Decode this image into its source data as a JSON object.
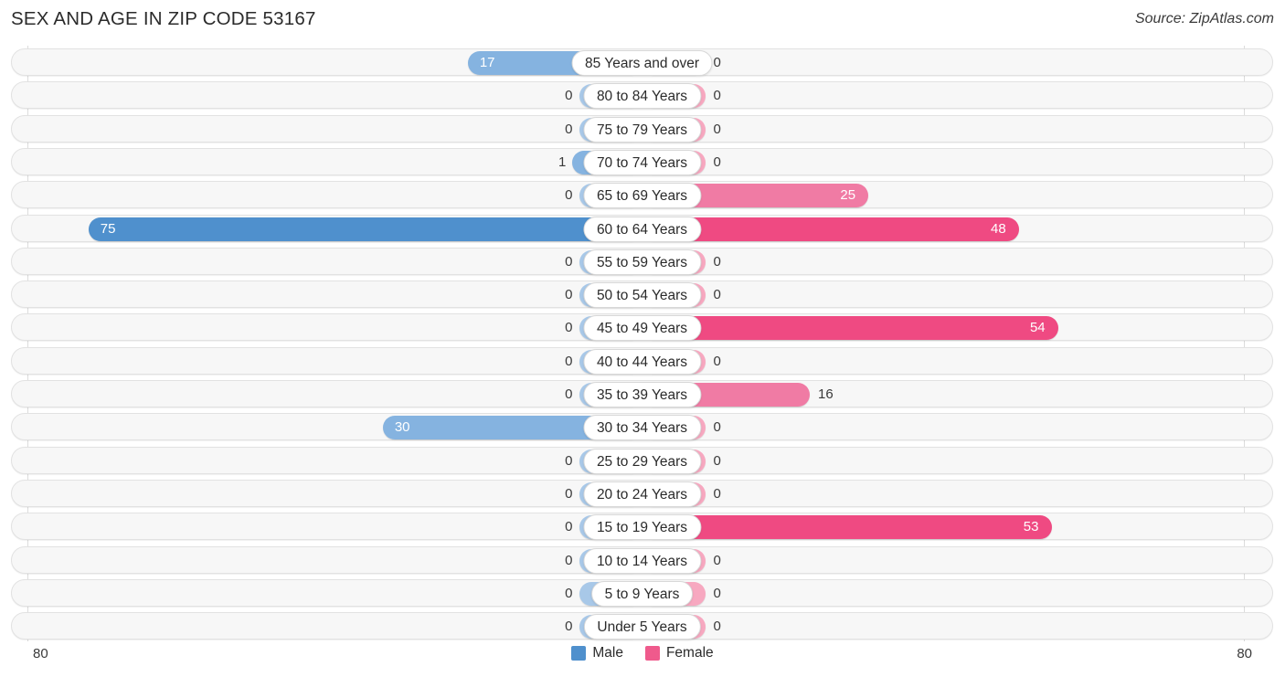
{
  "header": {
    "title": "SEX AND AGE IN ZIP CODE 53167",
    "source": "Source: ZipAtlas.com"
  },
  "legend": {
    "male_label": "Male",
    "female_label": "Female",
    "male_color": "#4f90cd",
    "female_color": "#ef5a8c"
  },
  "axis": {
    "left_max_label": "80",
    "right_max_label": "80",
    "max": 80
  },
  "colors": {
    "male_strong": "#4f90cd",
    "male_light": "#a8c8e8",
    "male_mid": "#85b3e0",
    "female_strong": "#ef4a82",
    "female_light": "#f7a8c0",
    "female_mid": "#f07ba4",
    "track": "#f7f7f7",
    "track_border": "#e2e2e2",
    "gridline": "#dcdcdc"
  },
  "chart_data": {
    "type": "bar",
    "title": "SEX AND AGE IN ZIP CODE 53167",
    "subtitle": "Source: ZipAtlas.com",
    "orientation": "horizontal-diverging",
    "xlabel": "",
    "ylabel": "",
    "xlim": [
      -80,
      80
    ],
    "grid": true,
    "legend_position": "bottom-center",
    "categories": [
      "85 Years and over",
      "80 to 84 Years",
      "75 to 79 Years",
      "70 to 74 Years",
      "65 to 69 Years",
      "60 to 64 Years",
      "55 to 59 Years",
      "50 to 54 Years",
      "45 to 49 Years",
      "40 to 44 Years",
      "35 to 39 Years",
      "30 to 34 Years",
      "25 to 29 Years",
      "20 to 24 Years",
      "15 to 19 Years",
      "10 to 14 Years",
      "5 to 9 Years",
      "Under 5 Years"
    ],
    "series": [
      {
        "name": "Male",
        "color": "#4f90cd",
        "values": [
          17,
          0,
          0,
          1,
          0,
          75,
          0,
          0,
          0,
          0,
          0,
          30,
          0,
          0,
          0,
          0,
          0,
          0
        ]
      },
      {
        "name": "Female",
        "color": "#ef5a8c",
        "values": [
          0,
          0,
          0,
          0,
          25,
          48,
          0,
          0,
          54,
          0,
          16,
          0,
          0,
          0,
          53,
          0,
          0,
          0
        ]
      }
    ]
  }
}
